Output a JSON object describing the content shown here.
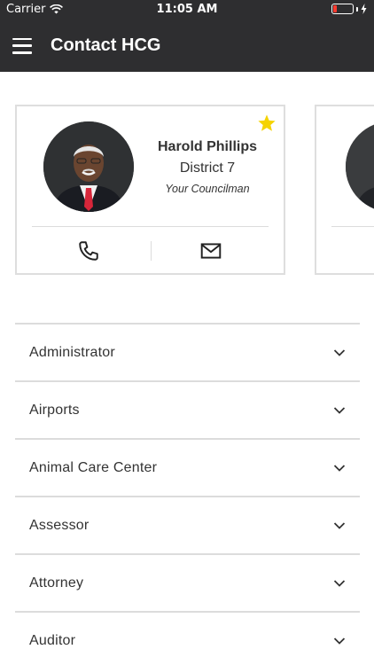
{
  "status_bar": {
    "carrier": "Carrier",
    "time": "11:05 AM",
    "wifi_icon": "wifi-icon",
    "battery_icon": "battery-low-icon",
    "battery_color": "#ff3b30"
  },
  "header": {
    "title": "Contact HCG",
    "menu_icon": "hamburger-menu-icon",
    "background": "#2e2e30"
  },
  "featured_contacts": [
    {
      "name": "Harold Phillips",
      "district": "District 7",
      "role": "Your Councilman",
      "favorite": true,
      "star_color": "#f5d300",
      "actions": [
        "phone-icon",
        "mail-icon"
      ]
    }
  ],
  "departments": [
    {
      "label": "Administrator"
    },
    {
      "label": "Airports"
    },
    {
      "label": "Animal Care Center"
    },
    {
      "label": "Assessor"
    },
    {
      "label": "Attorney"
    },
    {
      "label": "Auditor"
    }
  ]
}
